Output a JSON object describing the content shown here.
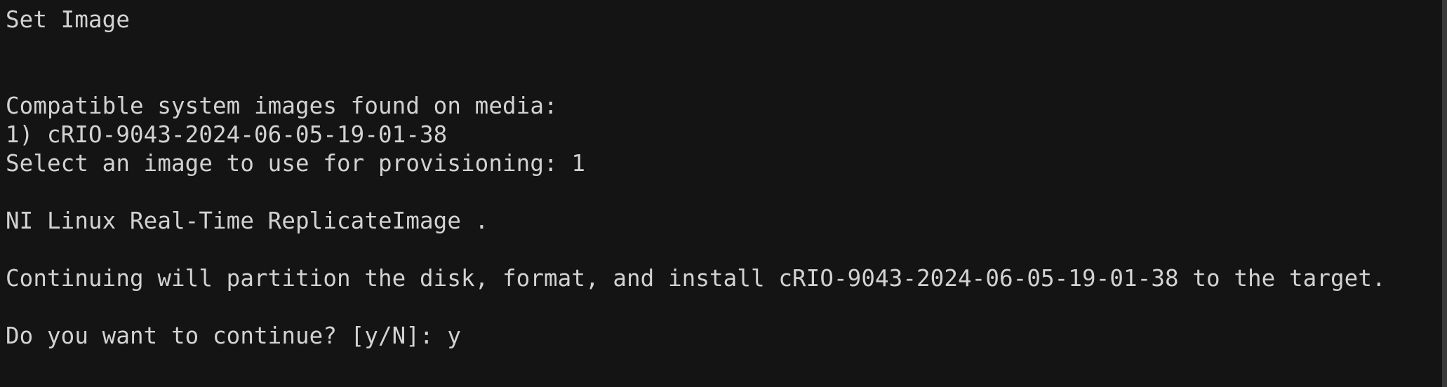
{
  "terminal": {
    "lines": [
      "Set Image",
      "",
      "",
      "Compatible system images found on media:",
      "1) cRIO-9043-2024-06-05-19-01-38",
      "Select an image to use for provisioning: 1",
      "",
      "NI Linux Real-Time ReplicateImage .",
      "",
      "Continuing will partition the disk, format, and install cRIO-9043-2024-06-05-19-01-38 to the target.",
      "",
      "Do you want to continue? [y/N]: y"
    ]
  },
  "colors": {
    "background": "#141414",
    "text": "#d2d2d2"
  }
}
